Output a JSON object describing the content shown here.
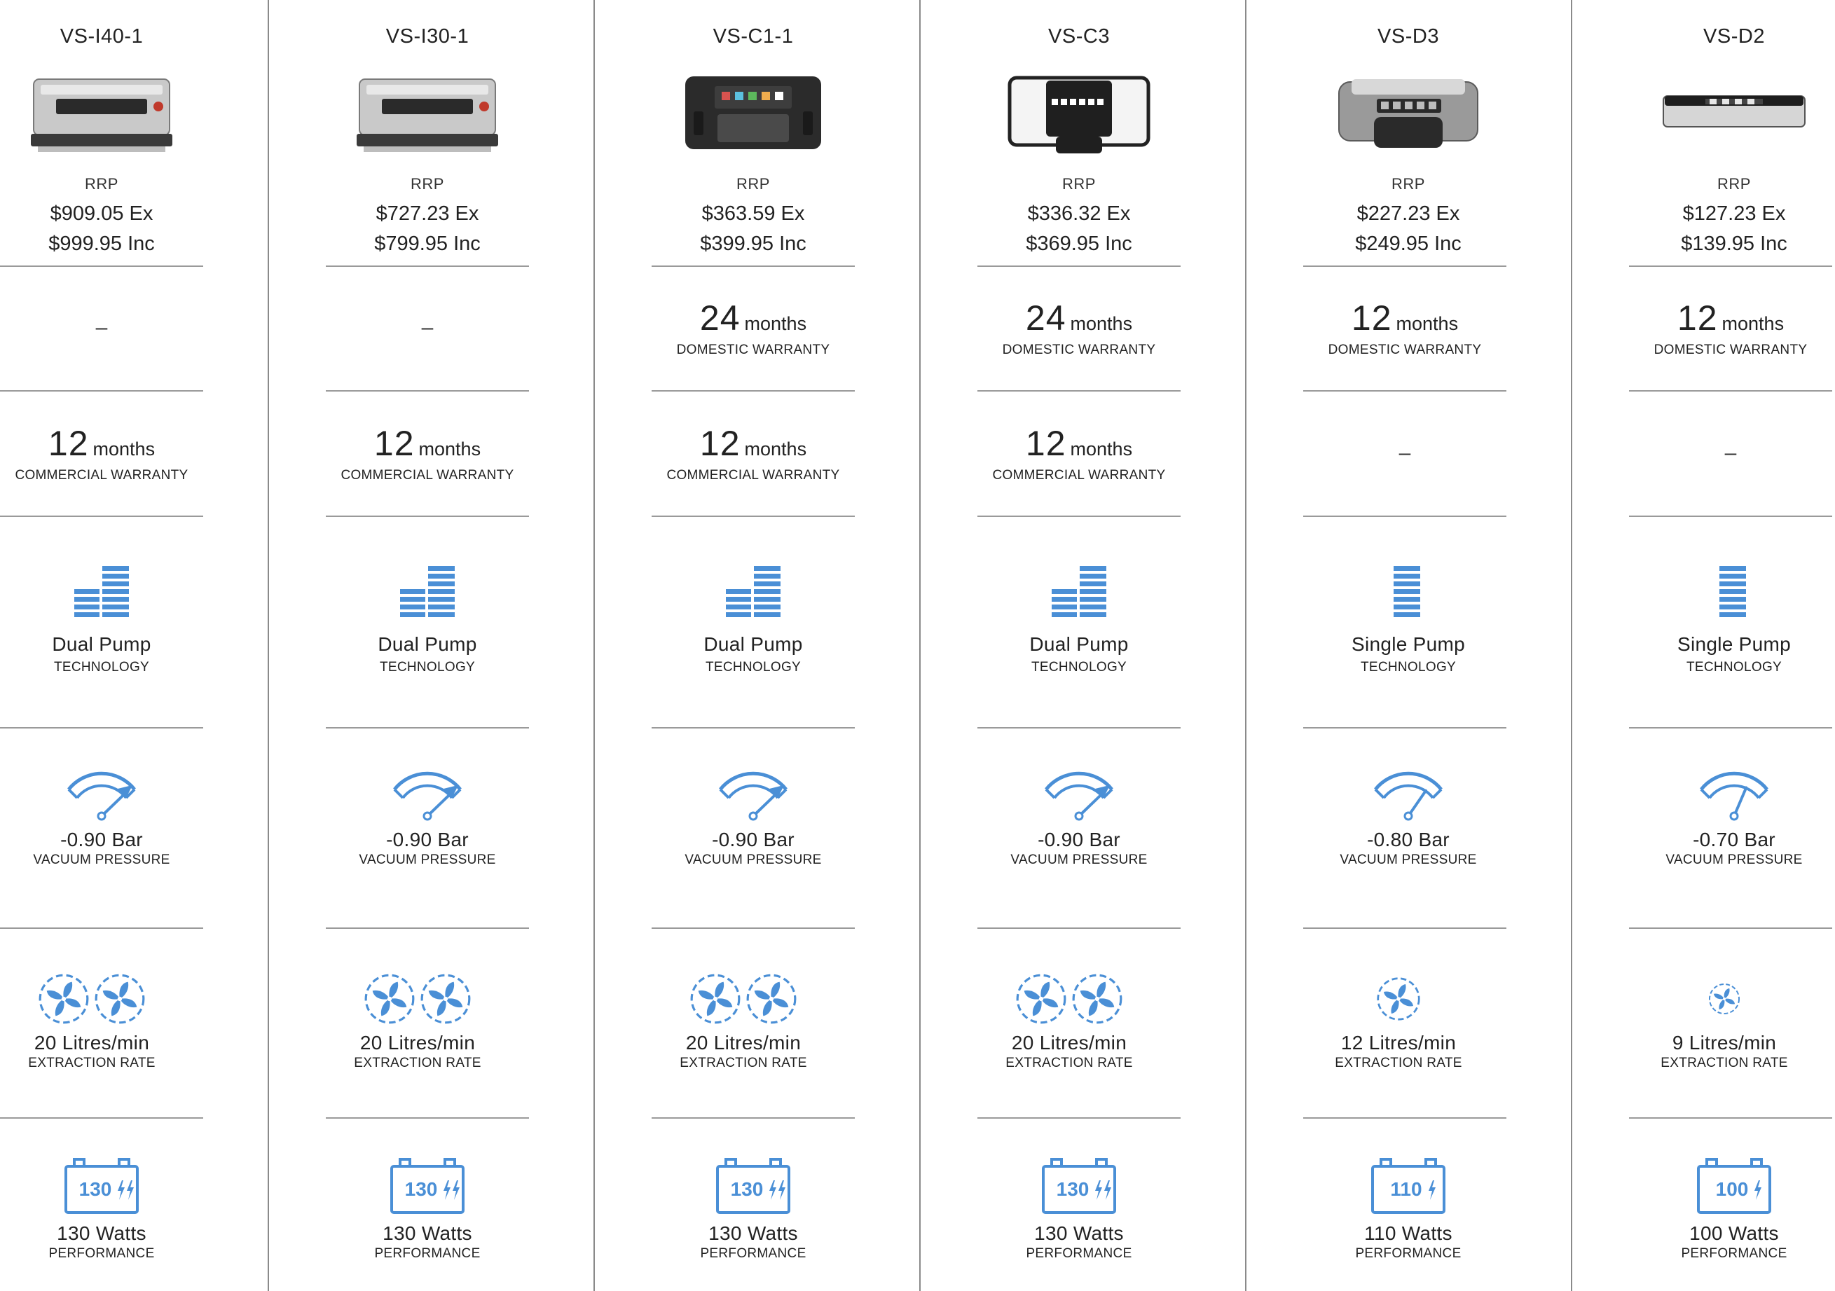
{
  "colors": {
    "accent": "#4a8fd6",
    "divider": "#8a8a8a",
    "text": "#222222"
  },
  "labels": {
    "rrp": "RRP",
    "domestic_warranty": "DOMESTIC WARRANTY",
    "commercial_warranty": "COMMERCIAL WARRANTY",
    "technology": "TECHNOLOGY",
    "vacuum_pressure": "VACUUM PRESSURE",
    "extraction_rate": "EXTRACTION RATE",
    "performance": "PERFORMANCE",
    "months": "months",
    "none": "–"
  },
  "products": [
    {
      "model": "VS-I40-1",
      "image_icon": "chamber-sealer-silver-icon",
      "price_ex": "$909.05 Ex",
      "price_inc": "$999.95 Inc",
      "domestic_warranty": "",
      "commercial_warranty": "12",
      "pump": "Dual Pump",
      "pump_icon": "dual-pump-bars-icon",
      "vacuum": "-0.90 Bar",
      "vacuum_level": 0.9,
      "extraction": "20 Litres/min",
      "fan_count": 2,
      "watts": "130 Watts",
      "watts_badge": "130",
      "bolt_count": 2
    },
    {
      "model": "VS-I30-1",
      "image_icon": "chamber-sealer-silver-icon",
      "price_ex": "$727.23 Ex",
      "price_inc": "$799.95 Inc",
      "domestic_warranty": "",
      "commercial_warranty": "12",
      "pump": "Dual Pump",
      "pump_icon": "dual-pump-bars-icon",
      "vacuum": "-0.90 Bar",
      "vacuum_level": 0.9,
      "extraction": "20 Litres/min",
      "fan_count": 2,
      "watts": "130 Watts",
      "watts_badge": "130",
      "bolt_count": 2
    },
    {
      "model": "VS-C1-1",
      "image_icon": "vacuum-sealer-black-icon",
      "price_ex": "$363.59 Ex",
      "price_inc": "$399.95 Inc",
      "domestic_warranty": "24",
      "commercial_warranty": "12",
      "pump": "Dual Pump",
      "pump_icon": "dual-pump-bars-icon",
      "vacuum": "-0.90 Bar",
      "vacuum_level": 0.9,
      "extraction": "20 Litres/min",
      "fan_count": 2,
      "watts": "130 Watts",
      "watts_badge": "130",
      "bolt_count": 2
    },
    {
      "model": "VS-C3",
      "image_icon": "vacuum-sealer-white-black-icon",
      "price_ex": "$336.32 Ex",
      "price_inc": "$369.95 Inc",
      "domestic_warranty": "24",
      "commercial_warranty": "12",
      "pump": "Dual Pump",
      "pump_icon": "dual-pump-bars-icon",
      "vacuum": "-0.90 Bar",
      "vacuum_level": 0.9,
      "extraction": "20 Litres/min",
      "fan_count": 2,
      "watts": "130 Watts",
      "watts_badge": "130",
      "bolt_count": 2
    },
    {
      "model": "VS-D3",
      "image_icon": "vacuum-sealer-grey-icon",
      "price_ex": "$227.23 Ex",
      "price_inc": "$249.95 Inc",
      "domestic_warranty": "12",
      "commercial_warranty": "",
      "pump": "Single Pump",
      "pump_icon": "single-pump-bars-icon",
      "vacuum": "-0.80 Bar",
      "vacuum_level": 0.8,
      "extraction": "12 Litres/min",
      "fan_count": 1,
      "watts": "110 Watts",
      "watts_badge": "110",
      "bolt_count": 1
    },
    {
      "model": "VS-D2",
      "image_icon": "vacuum-sealer-slim-icon",
      "price_ex": "$127.23 Ex",
      "price_inc": "$139.95 Inc",
      "domestic_warranty": "12",
      "commercial_warranty": "",
      "pump": "Single Pump",
      "pump_icon": "single-pump-bars-icon",
      "vacuum": "-0.70 Bar",
      "vacuum_level": 0.7,
      "extraction": "9 Litres/min",
      "fan_count": 1,
      "watts": "100 Watts",
      "watts_badge": "100",
      "bolt_count": 1
    }
  ]
}
